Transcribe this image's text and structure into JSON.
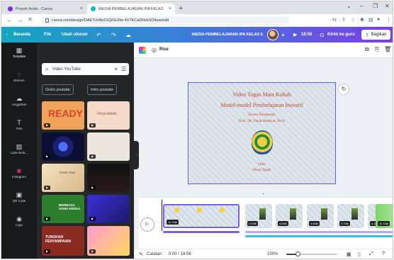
{
  "browser": {
    "tabs": [
      {
        "title": "Proyek Anda - Canva",
        "close": "×",
        "favicon_color": "#7d2ae8"
      },
      {
        "title": "MEDIA PEMBELAJARAN IPA KELAS",
        "close": "×",
        "favicon_color": "#00c4cc"
      }
    ],
    "new_tab": "+",
    "window_controls": [
      "⌄",
      "–",
      "❐",
      "✕"
    ],
    "url": "canva.com/design/DAE7UnBz01Q/GU0w-4V7KCaDNvkSO4uw/edit"
  },
  "header": {
    "back_label": "Beranda",
    "file_label": "File",
    "resize_label": "Ubah ukuran",
    "doc_title": "MEDIA PEMBELAJARAN IPA KELAS 6",
    "add_label": "+",
    "duration": "18:56",
    "send_label": "Kirim ke guru",
    "share_label": "Bagikan"
  },
  "rail": [
    {
      "icon": "▦",
      "label": "Template"
    },
    {
      "icon": "◌",
      "label": "Elemen"
    },
    {
      "icon": "☁",
      "label": "Unggahan"
    },
    {
      "icon": "T",
      "label": "Teks"
    },
    {
      "icon": "▧",
      "label": "Latar Bela..."
    },
    {
      "icon": "◙",
      "label": "Instagram"
    },
    {
      "icon": "▣",
      "label": "QR Code"
    },
    {
      "icon": "◉",
      "label": "Logo"
    }
  ],
  "panel": {
    "search_value": "Video YouTube",
    "clear": "×",
    "chips": [
      "Outro youtube",
      "Intro youtube"
    ],
    "thumbs": [
      {
        "text": "READY",
        "play": "▶"
      },
      {
        "text": "Fitrya Adelia",
        "play": "▶"
      },
      {
        "text": "",
        "play": "▶"
      },
      {
        "text": "",
        "play": "▶"
      },
      {
        "text": "Travel Vlog",
        "play": "▶"
      },
      {
        "text": "",
        "play": "▶"
      },
      {
        "text": "BERMASA SAMA KEDUA",
        "play": "▶"
      },
      {
        "text": "",
        "play": "▶"
      },
      {
        "text": "TUNGKAN FENYAMPAIAN",
        "play": "▶"
      },
      {
        "text": "",
        "play": "▶"
      }
    ]
  },
  "editor": {
    "anim_label": "Rise",
    "tool_icons": [
      "⧉",
      "⎘",
      "🗑"
    ]
  },
  "slide": {
    "line1": "Video Tugas Mata Kuliah",
    "line2": "Model-model Pembelajaran Inovatif",
    "line3": "Dosen Pengampu",
    "line4": "Prof. Dr. Yayat Ruhiyat, M.Si",
    "line5": "Oleh",
    "line6": "Ihsan Taqik"
  },
  "timeline": {
    "clips": [
      {
        "duration": "11.7dtk"
      },
      {
        "duration": "4.0dtk"
      },
      {
        "duration": "4.5dtk"
      },
      {
        "duration": "4.5dtk"
      },
      {
        "duration": "3.7dtk"
      },
      {
        "duration": "4.1dtk"
      },
      {
        "duration": "11.7dtk"
      }
    ]
  },
  "status": {
    "notes_label": "Catatan",
    "time_label": "0:00 / 18:56",
    "zoom_label": "100%",
    "zoom_level": 0.22
  },
  "colors": {
    "accent": "#7d5df1",
    "canva_teal": "#14a6bf",
    "canva_purple": "#7b3fe4",
    "slide_text": "#c4482f"
  }
}
